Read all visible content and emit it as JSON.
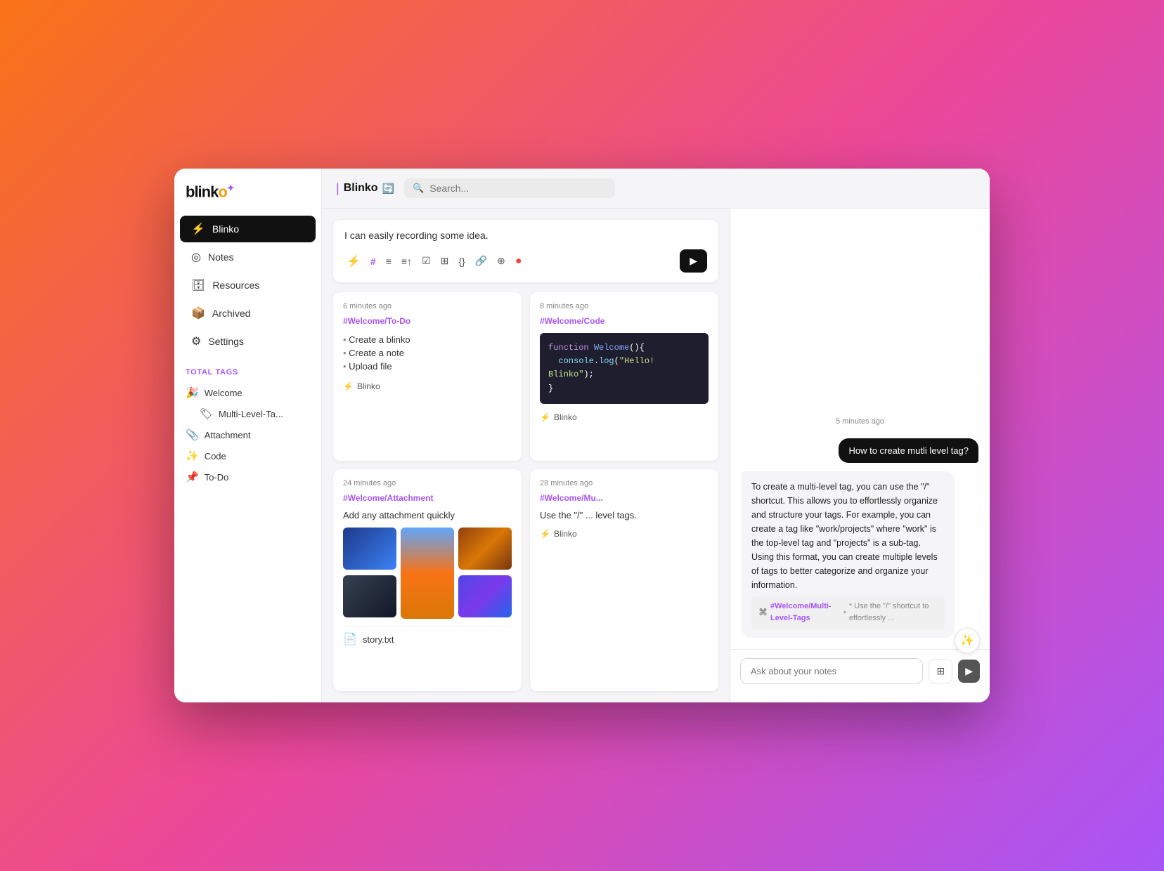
{
  "app": {
    "name": "blinko",
    "logo_text": "blink",
    "logo_suffix": "o"
  },
  "sidebar": {
    "nav_items": [
      {
        "id": "blinko",
        "label": "Blinko",
        "icon": "⚡",
        "active": true
      },
      {
        "id": "notes",
        "label": "Notes",
        "icon": "📝",
        "active": false
      },
      {
        "id": "resources",
        "label": "Resources",
        "icon": "🗄️",
        "active": false
      },
      {
        "id": "archived",
        "label": "Archived",
        "icon": "⚙️",
        "active": false
      },
      {
        "id": "settings",
        "label": "Settings",
        "icon": "⚙️",
        "active": false
      }
    ],
    "tags_label": "TOTAL TAGS",
    "tags": [
      {
        "emoji": "🎉",
        "label": "Welcome",
        "indent": false
      },
      {
        "emoji": "🏷️",
        "label": "Multi-Level-Ta...",
        "indent": true
      },
      {
        "emoji": "📎",
        "label": "Attachment",
        "indent": false
      },
      {
        "emoji": "✨",
        "label": "Code",
        "indent": false
      },
      {
        "emoji": "📌",
        "label": "To-Do",
        "indent": false
      }
    ]
  },
  "topbar": {
    "title": "Blinko",
    "search_placeholder": "Search..."
  },
  "input_area": {
    "placeholder": "I can easily recording some idea."
  },
  "toolbar": {
    "buttons": [
      "⚡",
      "#",
      "≡",
      "≡↑",
      "≡×",
      "⊞",
      "{}",
      "🔗",
      "⊕",
      "●"
    ]
  },
  "cards": [
    {
      "id": "todo",
      "time": "6 minutes ago",
      "tag": "#Welcome/To-Do",
      "items": [
        "Create a blinko",
        "Create a note",
        "Upload file"
      ],
      "footer_user": "Blinko"
    },
    {
      "id": "code",
      "time": "8 minutes ago",
      "tag": "#Welcome/Code",
      "code": {
        "line1": "function Welcome(){",
        "line2": "  console.log(\"Hello! Blinko\");",
        "line3": "}"
      },
      "footer_user": "Blinko"
    },
    {
      "id": "attachment",
      "time": "24 minutes ago",
      "tag": "#Welcome/Attachment",
      "description": "Add any attachment quickly",
      "file": "story.txt",
      "footer_user": "Blinko"
    },
    {
      "id": "multilevel",
      "time": "28 minutes ago",
      "tag": "#Welcome/Mu...",
      "description": "Use the \"/\" ... level tags.",
      "footer_user": "Blinko"
    }
  ],
  "ai_chat": {
    "timestamp": "5 minutes ago",
    "user_message": "How to create mutli level tag?",
    "ai_response": "To create a multi-level tag, you can use the \"/\" shortcut. This allows you to effortlessly organize and structure your tags. For example, you can create a tag like \"work/projects\" where \"work\" is the top-level tag and \"projects\" is a sub-tag. Using this format, you can create multiple levels of tags to better categorize and organize your information.",
    "source_tag": "#Welcome/Multi-Level-Tags",
    "source_preview": "* Use the \"/\" shortcut to effortlessly ...",
    "input_placeholder": "Ask about your notes",
    "fab_icon": "✨"
  }
}
